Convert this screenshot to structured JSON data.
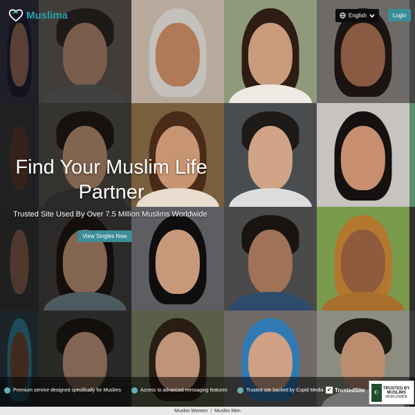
{
  "brand": {
    "logo_text": "Muslima"
  },
  "header": {
    "language_label": "English",
    "login_label": "Login"
  },
  "hero": {
    "title": "Find Your Muslim Life Partner",
    "subtitle": "Trusted Site Used By Over 7.5 Million Muslims Worldwide",
    "cta_label": "View Singles Now"
  },
  "features": [
    {
      "text": "Premium service designed specifically for Muslims"
    },
    {
      "text": "Access to advanced messaging features"
    },
    {
      "text": "Trusted site backed by Cupid Media"
    }
  ],
  "trusted_site": {
    "label": "TrustedSite"
  },
  "badge": {
    "line1": "TRUSTED BY",
    "line2": "MUSLIMS",
    "line3": "WORLDWIDE"
  },
  "footer": {
    "link1": "Muslim Women",
    "separator": "|",
    "link2": "Muslim Men"
  },
  "colors": {
    "accent": "#3a8f96",
    "logo": "#2a9fb0",
    "dot": "#6aaeb3"
  }
}
